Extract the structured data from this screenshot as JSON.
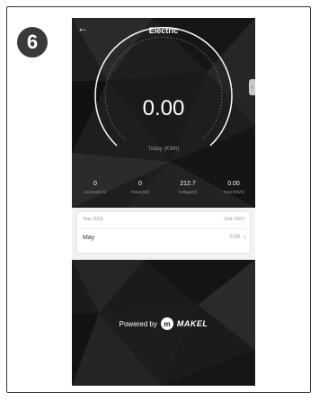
{
  "step": {
    "number": "6"
  },
  "header": {
    "title": "Electric",
    "back_icon": "arrow-left-icon"
  },
  "meter": {
    "value": "0.00",
    "label": "Today (KWh)"
  },
  "stats": [
    {
      "value": "0",
      "label": "Current(mA)"
    },
    {
      "value": "0",
      "label": "Power(W)"
    },
    {
      "value": "212.7",
      "label": "Voltage(V)"
    },
    {
      "value": "0.00",
      "label": "Total (KWh)"
    }
  ],
  "history": {
    "year": "Year 2024",
    "unit": "Unit: kW.h",
    "month": "May",
    "month_value": "0.00"
  },
  "footer": {
    "powered_by": "Powered by",
    "logo_letter": "m",
    "brand": "MAKEL"
  }
}
